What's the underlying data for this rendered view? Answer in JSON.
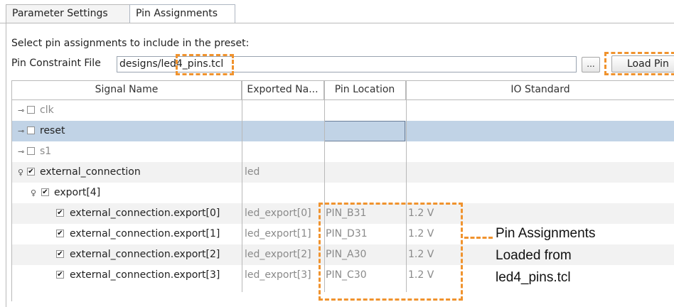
{
  "tabs": [
    {
      "label": "Parameter Settings"
    },
    {
      "label": "Pin Assignments"
    }
  ],
  "instruction": "Select pin assignments to include in the preset:",
  "pin_constraint": {
    "label": "Pin Constraint File",
    "value": "designs/led4_pins.tcl",
    "browse_label": "...",
    "load_label": "Load Pin"
  },
  "table": {
    "columns": [
      "Signal Name",
      "Exported Na...",
      "Pin Location",
      "IO Standard"
    ],
    "rows": [
      {
        "name": "clk",
        "exported": "",
        "pin": "",
        "io": ""
      },
      {
        "name": "reset",
        "exported": "",
        "pin": "",
        "io": ""
      },
      {
        "name": "s1",
        "exported": "",
        "pin": "",
        "io": ""
      },
      {
        "name": "external_connection",
        "exported": "led",
        "pin": "",
        "io": ""
      },
      {
        "name": "export[4]",
        "exported": "",
        "pin": "",
        "io": ""
      },
      {
        "name": "external_connection.export[0]",
        "exported": "led_export[0]",
        "pin": "PIN_B31",
        "io": "1.2 V"
      },
      {
        "name": "external_connection.export[1]",
        "exported": "led_export[1]",
        "pin": "PIN_D31",
        "io": "1.2 V"
      },
      {
        "name": "external_connection.export[2]",
        "exported": "led_export[2]",
        "pin": "PIN_A30",
        "io": "1.2 V"
      },
      {
        "name": "external_connection.export[3]",
        "exported": "led_export[3]",
        "pin": "PIN_C30",
        "io": "1.2 V"
      }
    ]
  },
  "callout": {
    "lines": [
      "Pin Assignments",
      "Loaded from",
      "led4_pins.tcl"
    ],
    "color": "#f0932e"
  },
  "colors": {
    "selection": "#c1d3e6",
    "accent": "#f0932e"
  }
}
